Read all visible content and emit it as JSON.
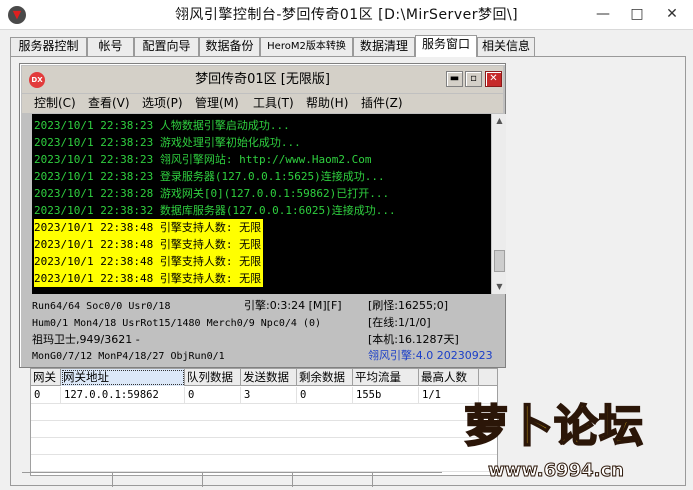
{
  "window": {
    "title": "翎风引擎控制台-梦回传奇01区 [D:\\MirServer梦回\\]",
    "icon": "chevron-down-logo-icon",
    "buttons": {
      "minimize": "—",
      "maximize": "□",
      "close": "✕"
    }
  },
  "tabs": [
    {
      "label": "服务器控制",
      "active": false
    },
    {
      "label": "帐号",
      "active": false
    },
    {
      "label": "配置向导",
      "active": false
    },
    {
      "label": "数据备份",
      "active": false
    },
    {
      "label": "HeroM2版本转换",
      "active": false
    },
    {
      "label": "数据清理",
      "active": false
    },
    {
      "label": "服务窗口",
      "active": true
    },
    {
      "label": "相关信息",
      "active": false
    }
  ],
  "console_window": {
    "icon_label": "DX",
    "title": "梦回传奇01区 [无限版]",
    "buttons": {
      "minimize": "▬",
      "maximize": "▫",
      "close": "✕"
    },
    "menu": [
      "控制(C)",
      "查看(V)",
      "选项(P)",
      "管理(M)",
      "工具(T)",
      "帮助(H)",
      "插件(Z)"
    ],
    "log": [
      {
        "text": "2023/10/1 22:38:23 人物数据引擎启动成功...",
        "style": "green"
      },
      {
        "text": "2023/10/1 22:38:23 游戏处理引擎初始化成功...",
        "style": "green"
      },
      {
        "text": "2023/10/1 22:38:23 翎风引擎网站: http://www.Haom2.Com",
        "style": "green"
      },
      {
        "text": "2023/10/1 22:38:23 登录服务器(127.0.0.1:5625)连接成功...",
        "style": "green"
      },
      {
        "text": "2023/10/1 22:38:28 游戏网关[0](127.0.0.1:59862)已打开...",
        "style": "green"
      },
      {
        "text": "2023/10/1 22:38:32 数据库服务器(127.0.0.1:6025)连接成功...",
        "style": "green"
      },
      {
        "text": "2023/10/1 22:38:48 引擎支持人数: 无限",
        "style": "highlight"
      },
      {
        "text": "2023/10/1 22:38:48 引擎支持人数: 无限",
        "style": "highlight"
      },
      {
        "text": "2023/10/1 22:38:48 引擎支持人数: 无限",
        "style": "highlight"
      },
      {
        "text": "2023/10/1 22:38:48 引擎支持人数: 无限",
        "style": "highlight"
      }
    ],
    "stats": {
      "run": "Run64/64 Soc0/0 Usr0/18",
      "engine": "引擎:0:3:24 [M][F]",
      "refresh": "[刷怪:16255;0]",
      "hum": "Hum0/1 Mon4/18 UsrRot15/1480 Merch0/9 Npc0/4 (0)",
      "online": "[在线:1/1/0]",
      "guard": "祖玛卫士,949/3621 -",
      "local": "[本机:16.1287天]",
      "mon": "MonG0/7/12 MonP4/18/27 ObjRun0/1",
      "version": "翎风引擎:4.0 20230923"
    }
  },
  "gateway_table": {
    "columns": [
      "网关",
      "网关地址",
      "队列数据",
      "发送数据",
      "剩余数据",
      "平均流量",
      "最高人数"
    ],
    "rows": [
      [
        "0",
        "127.0.0.1:59862",
        "0",
        "3",
        "0",
        "155b",
        "1/1"
      ]
    ]
  },
  "watermark": {
    "text": "萝卜论坛",
    "url": "www.6994.cn"
  },
  "colors": {
    "log_green": "#2fcf3f",
    "log_highlight": "#ffff00",
    "console_bg": "#000000",
    "version_blue": "#1a3ec8",
    "close_red": "#c62a2a"
  }
}
